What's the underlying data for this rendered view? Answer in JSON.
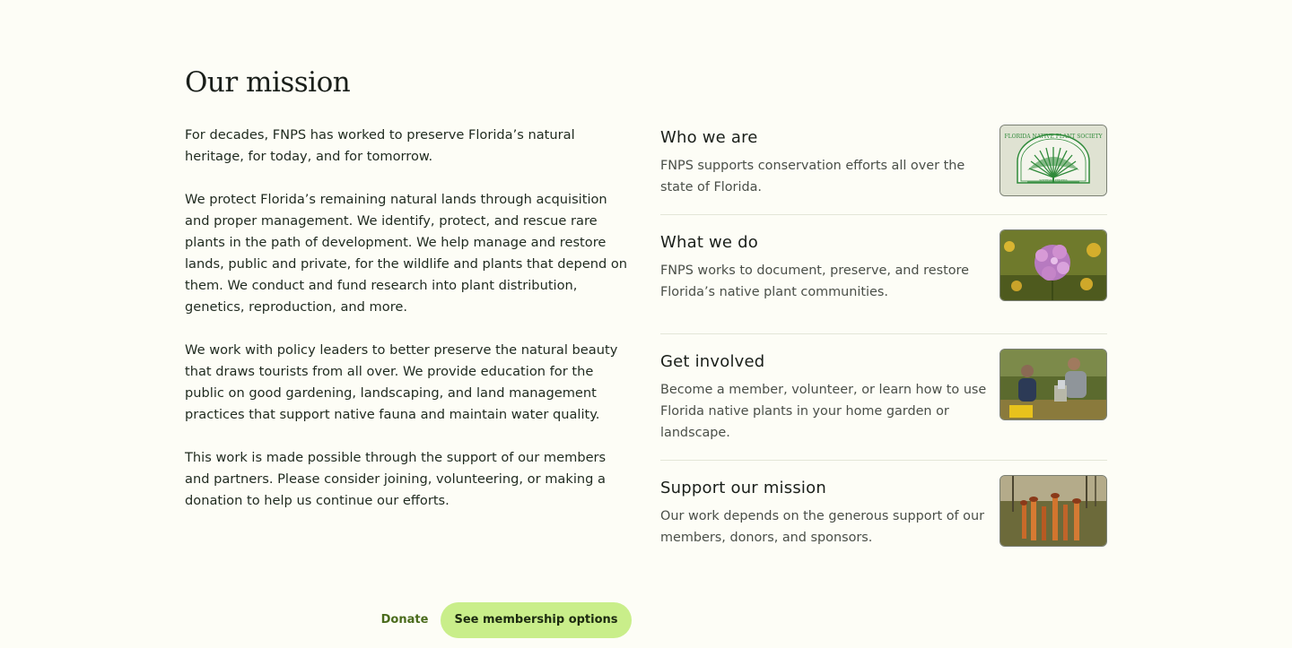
{
  "section": {
    "title": "Our mission"
  },
  "paragraphs": [
    "For decades, FNPS has worked to preserve Florida’s natural heritage, for today, and for tomorrow.",
    "We protect Florida’s remaining natural lands through acquisition and proper management. We identify, protect, and rescue rare plants in the path of development. We help manage and restore lands, public and private, for the wildlife and plants that depend on them. We conduct and fund research into plant distribution, genetics, reproduction, and more.",
    "We work with policy leaders to better preserve the natural beauty that draws tourists from all over. We provide education for the public on good gardening, landscaping, and land management practices that support native fauna and maintain water quality.",
    "This work is made possible through the support of our members and partners. Please consider joining, volunteering, or making a donation to help us continue our efforts."
  ],
  "actions": {
    "donate_label": "Donate",
    "membership_label": "See membership options"
  },
  "cards": [
    {
      "title": "Who we are",
      "description": "FNPS supports conservation efforts all over the state of Florida.",
      "image": "fnps-logo"
    },
    {
      "title": "What we do",
      "description": "FNPS works to document, preserve, and restore Florida’s native plant communities.",
      "image": "pink-wildflower-photo"
    },
    {
      "title": "Get involved",
      "description": "Become a member, volunteer, or learn how to use Florida native plants in your home garden or landscape.",
      "image": "volunteers-planting-photo"
    },
    {
      "title": "Support our mission",
      "description": "Our work depends on the generous support of our members, donors, and sponsors.",
      "image": "pitcher-plants-photo"
    }
  ],
  "logo": {
    "text": "FLORIDA NATIVE PLANT SOCIETY",
    "tagline": "serenoa repens"
  },
  "colors": {
    "background": "#fdfdf6",
    "accent_button": "#c9ee8a",
    "donate_text": "#4a6b1c",
    "logo_green": "#2f8a3a"
  }
}
